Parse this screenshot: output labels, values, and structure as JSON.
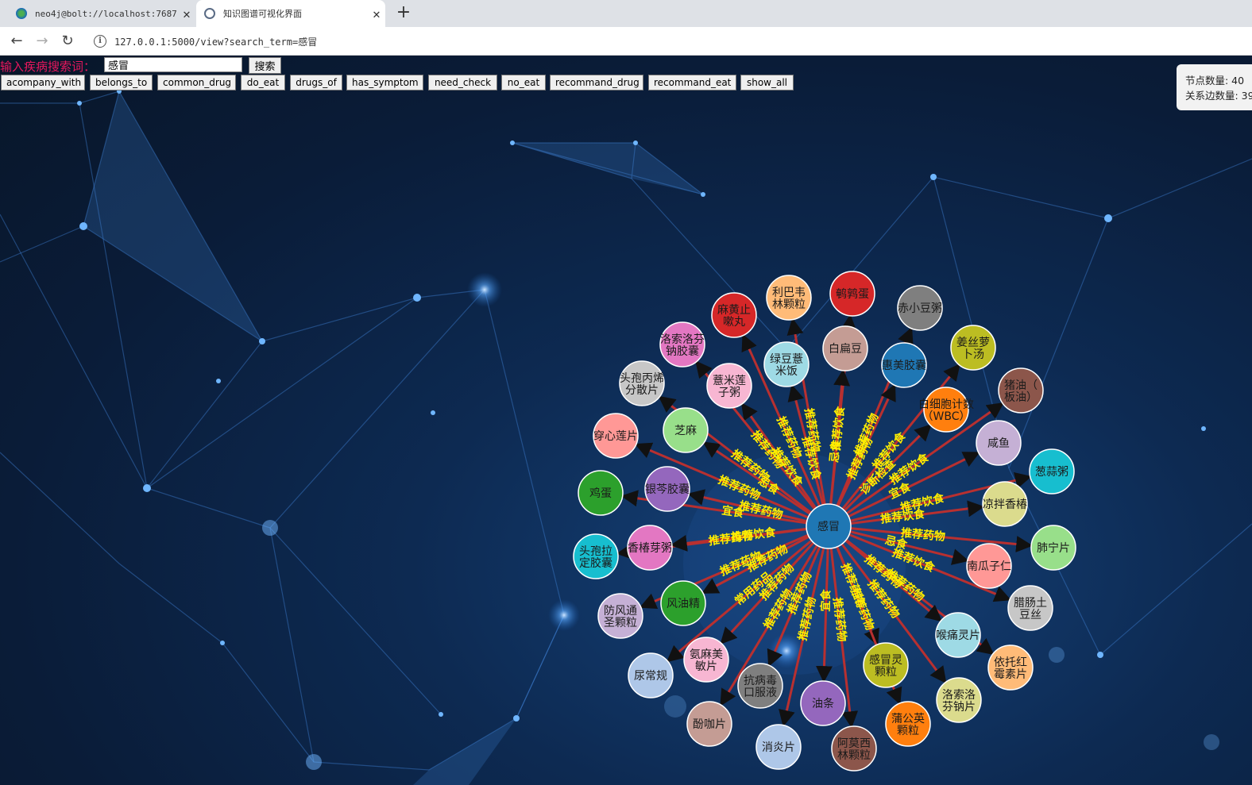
{
  "browser": {
    "tabs": [
      {
        "title": "neo4j@bolt://localhost:7687 -",
        "close": "✕"
      },
      {
        "title": "知识图谱可视化界面",
        "close": "✕"
      }
    ],
    "new_tab": "+",
    "url": "127.0.0.1:5000/view?search_term=感冒",
    "icons": [
      "back-icon",
      "forward-icon",
      "reload-icon",
      "info-icon"
    ]
  },
  "search": {
    "label": "输入疾病搜索词：",
    "value": "感冒",
    "button": "搜索"
  },
  "filters": [
    "acompany_with",
    "belongs_to",
    "common_drug",
    "do_eat",
    "drugs_of",
    "has_symptom",
    "need_check",
    "no_eat",
    "recommand_drug",
    "recommand_eat",
    "show_all"
  ],
  "stats": {
    "node_count": "节点数量: 40",
    "edge_count": "关系边数量: 39"
  },
  "graph": {
    "center": {
      "label": "感冒",
      "color": "#1f77b4"
    },
    "nodes": [
      {
        "label": "鹌鹑蛋",
        "color": "#d62728"
      },
      {
        "label": "赤小豆粥",
        "color": "#7f7f7f"
      },
      {
        "label": "姜丝萝卜汤",
        "color": "#bcbd22"
      },
      {
        "label": "猪油（板油）",
        "color": "#8c564b"
      },
      {
        "label": "咸鱼",
        "color": "#c5b0d5"
      },
      {
        "label": "葱蒜粥",
        "color": "#17becf"
      },
      {
        "label": "凉拌香椿",
        "color": "#dbdb8d"
      },
      {
        "label": "肺宁片",
        "color": "#98df8a"
      },
      {
        "label": "腊肠土豆丝",
        "color": "#c7c7c7"
      },
      {
        "label": "南瓜子仁",
        "color": "#ff9896"
      },
      {
        "label": "依托红霉素片",
        "color": "#ffbb78"
      },
      {
        "label": "喉痛灵片",
        "color": "#9edae5"
      },
      {
        "label": "洛索洛芬钠片",
        "color": "#dbdb8d"
      },
      {
        "label": "感冒灵颗粒",
        "color": "#bcbd22"
      },
      {
        "label": "蒲公英颗粒",
        "color": "#ff7f0e"
      },
      {
        "label": "阿莫西林颗粒",
        "color": "#8c564b"
      },
      {
        "label": "油条",
        "color": "#9467bd"
      },
      {
        "label": "消炎片",
        "color": "#aec7e8"
      },
      {
        "label": "抗病毒口服液",
        "color": "#7f7f7f"
      },
      {
        "label": "酚咖片",
        "color": "#c49c94"
      },
      {
        "label": "氨麻美敏片",
        "color": "#f7b6d2"
      },
      {
        "label": "尿常规",
        "color": "#aec7e8"
      },
      {
        "label": "防风通圣颗粒",
        "color": "#c5b0d5"
      },
      {
        "label": "风油精",
        "color": "#2ca02c"
      },
      {
        "label": "头孢拉定胶囊",
        "color": "#17becf"
      },
      {
        "label": "香椿芽粥",
        "color": "#e377c2"
      },
      {
        "label": "鸡蛋",
        "color": "#2ca02c"
      },
      {
        "label": "银芩胶囊",
        "color": "#9467bd"
      },
      {
        "label": "穿心莲片",
        "color": "#ff9896"
      },
      {
        "label": "芝麻",
        "color": "#98df8a"
      },
      {
        "label": "头孢丙烯分散片",
        "color": "#c7c7c7"
      },
      {
        "label": "薏米莲子粥",
        "color": "#f7b6d2"
      },
      {
        "label": "洛索洛芬钠胶囊",
        "color": "#e377c2"
      },
      {
        "label": "麻黄止嗽丸",
        "color": "#d62728"
      },
      {
        "label": "利巴韦林颗粒",
        "color": "#ffbb78"
      },
      {
        "label": "绿豆薏米饭",
        "color": "#9edae5"
      },
      {
        "label": "白扁豆",
        "color": "#c49c94"
      },
      {
        "label": "惠美胶囊",
        "color": "#1f77b4"
      },
      {
        "label": "白细胞计数（WBC）",
        "color": "#ff7f0e"
      }
    ],
    "edge_labels": [
      "推荐饮食",
      "推荐药物",
      "宜食",
      "忌食",
      "常用药品",
      "诊断检查"
    ],
    "edge_color": "#b83030",
    "label_color": "#ffee00"
  }
}
